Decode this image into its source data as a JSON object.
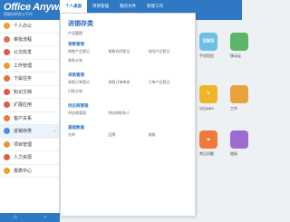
{
  "header": {
    "logo": "Office Anywhere",
    "subtitle": "智能协同办公平台",
    "tabs": [
      "个人桌面",
      "项目管理",
      "我的文件",
      "新建工作"
    ]
  },
  "sidebar": {
    "items": [
      {
        "label": "个人办公",
        "color": "#f0a030"
      },
      {
        "label": "审批流程",
        "color": "#e06d5a"
      },
      {
        "label": "公文收发",
        "color": "#e0584a"
      },
      {
        "label": "工作管理",
        "color": "#f29b2c"
      },
      {
        "label": "下属任务",
        "color": "#e86e3c"
      },
      {
        "label": "知识文档",
        "color": "#e25a45"
      },
      {
        "label": "扩展应用",
        "color": "#e4584f"
      },
      {
        "label": "客户关系",
        "color": "#ee7a3a"
      },
      {
        "label": "进销存类",
        "color": "#4a90d9"
      },
      {
        "label": "项目管理",
        "color": "#e8963a"
      },
      {
        "label": "人力资源",
        "color": "#e25e47"
      },
      {
        "label": "报表中心",
        "color": "#f0a030"
      }
    ],
    "active_index": 8,
    "bottom_home": "⌂",
    "bottom_back": "‹"
  },
  "panel": {
    "title": "进销存类",
    "top_link": "产品管理",
    "sections": [
      {
        "title": "销售管理",
        "links": [
          "销售产品登记",
          "销售合同登记",
          "合同产品登记",
          "收款计划"
        ]
      },
      {
        "title": "采购管理",
        "links": [
          "采购订单登记",
          "采购订单审核",
          "订单产品登记",
          "付款计划"
        ]
      },
      {
        "title": "供应商管理",
        "links": [
          "供应商管理",
          "供应商联系人"
        ]
      },
      {
        "title": "基础数据",
        "links": [
          "仓库",
          "品牌",
          "规格"
        ]
      }
    ]
  },
  "tiles": [
    {
      "label": "手机短信",
      "glyph": "SMS",
      "color": "#6cc0e5"
    },
    {
      "label": "论坛BBS",
      "glyph": "❞",
      "color": "#f0b429"
    },
    {
      "label": "常见问题",
      "glyph": "✦",
      "color": "#ef7b3a"
    }
  ],
  "tiles_partial": [
    {
      "label": "移动云",
      "color": "#5bb56b"
    },
    {
      "label": "工作",
      "color": "#e8a33c"
    },
    {
      "label": "链接",
      "color": "#9b6bd0"
    }
  ]
}
